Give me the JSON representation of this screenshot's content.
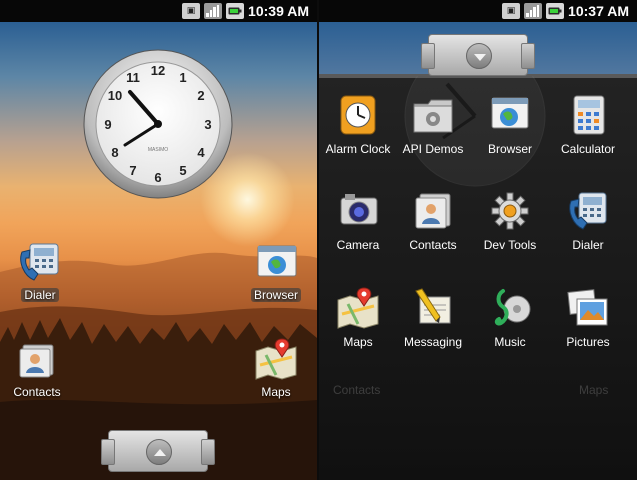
{
  "left_screen": {
    "status_time": "10:39 AM",
    "shortcuts": [
      {
        "label": "Dialer",
        "icon": "dialer-icon"
      },
      {
        "label": "Browser",
        "icon": "browser-icon"
      },
      {
        "label": "Contacts",
        "icon": "contacts-icon"
      },
      {
        "label": "Maps",
        "icon": "maps-icon"
      }
    ],
    "clock": {
      "hour": 10,
      "minute": 39,
      "brand": "MASIMO"
    }
  },
  "right_screen": {
    "status_time": "10:37 AM",
    "apps": [
      {
        "label": "Alarm Clock",
        "icon": "alarm-clock-icon"
      },
      {
        "label": "API Demos",
        "icon": "api-demos-icon"
      },
      {
        "label": "Browser",
        "icon": "browser-icon"
      },
      {
        "label": "Calculator",
        "icon": "calculator-icon"
      },
      {
        "label": "Camera",
        "icon": "camera-icon"
      },
      {
        "label": "Contacts",
        "icon": "contacts-icon"
      },
      {
        "label": "Dev Tools",
        "icon": "dev-tools-icon"
      },
      {
        "label": "Dialer",
        "icon": "dialer-icon"
      },
      {
        "label": "Maps",
        "icon": "maps-icon"
      },
      {
        "label": "Messaging",
        "icon": "messaging-icon"
      },
      {
        "label": "Music",
        "icon": "music-icon"
      },
      {
        "label": "Pictures",
        "icon": "pictures-icon"
      }
    ],
    "ghost_labels": [
      "Contacts",
      "Maps"
    ]
  },
  "status_icons": [
    "sim-icon",
    "signal-icon",
    "battery-icon"
  ]
}
